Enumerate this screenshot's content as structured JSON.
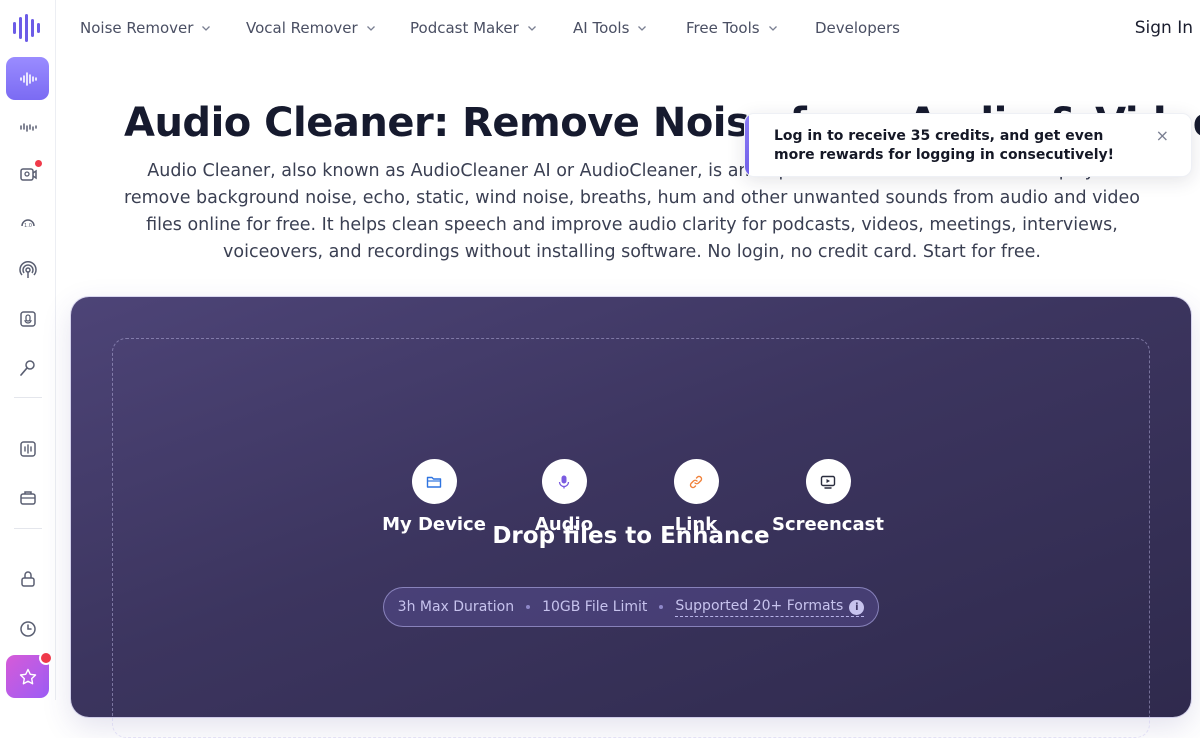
{
  "nav": {
    "items": [
      {
        "label": "Noise Remover",
        "has_menu": true
      },
      {
        "label": "Vocal Remover",
        "has_menu": true
      },
      {
        "label": "Podcast Maker",
        "has_menu": true
      },
      {
        "label": "AI Tools",
        "has_menu": true
      },
      {
        "label": "Free Tools",
        "has_menu": true
      },
      {
        "label": "Developers",
        "has_menu": false
      }
    ],
    "sign_in": "Sign In"
  },
  "sidebar": {
    "icons": [
      "waveform-icon",
      "noise-bars-icon",
      "video-recorder-icon",
      "speed-icon",
      "podcast-icon",
      "mic-record-icon",
      "voice-changer-icon",
      "audio-editor-icon",
      "toolbox-icon",
      "lock-icon",
      "history-icon",
      "star-icon"
    ],
    "accent": "#7b6bf3"
  },
  "hero": {
    "title": "Audio Cleaner: Remove Noise from Audio & Video",
    "description": "Audio Cleaner, also known as AudioCleaner AI or AudioCleaner, is an AI-powered noise remover that helps you remove background noise, echo, static, wind noise, breaths, hum and other unwanted sounds from audio and video files online for free. It helps clean speech and improve audio clarity for podcasts, videos, meetings, interviews, voiceovers, and recordings without installing software. No login, no credit card. Start for free."
  },
  "toast": {
    "message": "Log in to receive 35 credits, and get even more rewards for logging in consecutively!",
    "close": "×"
  },
  "upload": {
    "sources": [
      {
        "label": "My Device",
        "icon": "folder-icon",
        "color": "#2f74e0"
      },
      {
        "label": "Audio",
        "icon": "microphone-icon",
        "color": "#7a5be0"
      },
      {
        "label": "Link",
        "icon": "link-icon",
        "color": "#f0813a"
      },
      {
        "label": "Screencast",
        "icon": "screen-icon",
        "color": "#2a2d3e"
      }
    ],
    "drop_title": "Drop files to Enhance",
    "limits": {
      "duration": "3h Max Duration",
      "size": "10GB File Limit",
      "formats": "Supported 20+ Formats"
    },
    "info": "i"
  }
}
